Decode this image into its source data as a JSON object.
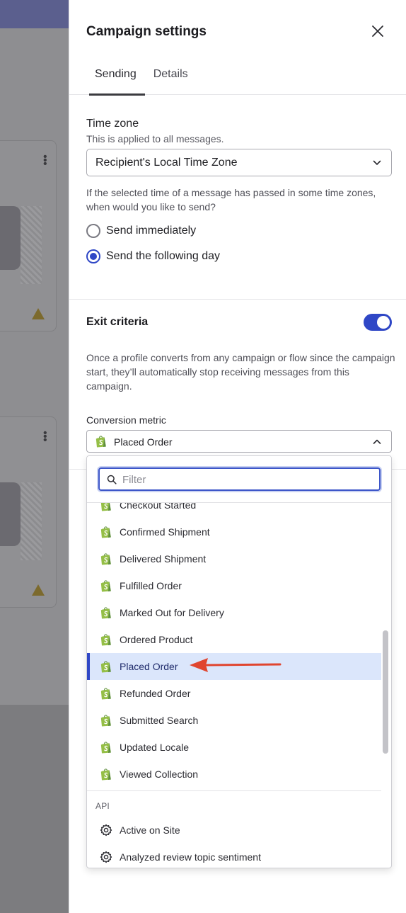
{
  "panel": {
    "title": "Campaign settings",
    "close_icon": "close-icon",
    "tabs": [
      {
        "label": "Sending",
        "active": true
      },
      {
        "label": "Details",
        "active": false
      }
    ]
  },
  "timezone": {
    "label": "Time zone",
    "sublabel": "This is applied to all messages.",
    "selected": "Recipient's Local Time Zone",
    "help": "If the selected time of a message has passed in some time zones, when would you like to send?",
    "options": [
      {
        "label": "Send immediately",
        "checked": false
      },
      {
        "label": "Send the following day",
        "checked": true
      }
    ]
  },
  "exit": {
    "title": "Exit criteria",
    "enabled": true,
    "description": "Once a profile converts from any campaign or flow since the campaign start, they’ll automatically stop receiving messages from this campaign.",
    "metric_label": "Conversion metric",
    "metric_selected": "Placed Order"
  },
  "dropdown": {
    "filter_placeholder": "Filter",
    "shopify_items": [
      "Checkout Started",
      "Confirmed Shipment",
      "Delivered Shipment",
      "Fulfilled Order",
      "Marked Out for Delivery",
      "Ordered Product",
      "Placed Order",
      "Refunded Order",
      "Submitted Search",
      "Updated Locale",
      "Viewed Collection"
    ],
    "selected_item": "Placed Order",
    "api_group_label": "API",
    "api_items": [
      "Active on Site",
      "Analyzed review topic sentiment"
    ]
  },
  "colors": {
    "accent": "#2f47c6",
    "selected_bg": "#dbe6fb",
    "shopify_green": "#95bf47",
    "arrow_red": "#e0452f",
    "overlay": "#7b7b7e"
  }
}
